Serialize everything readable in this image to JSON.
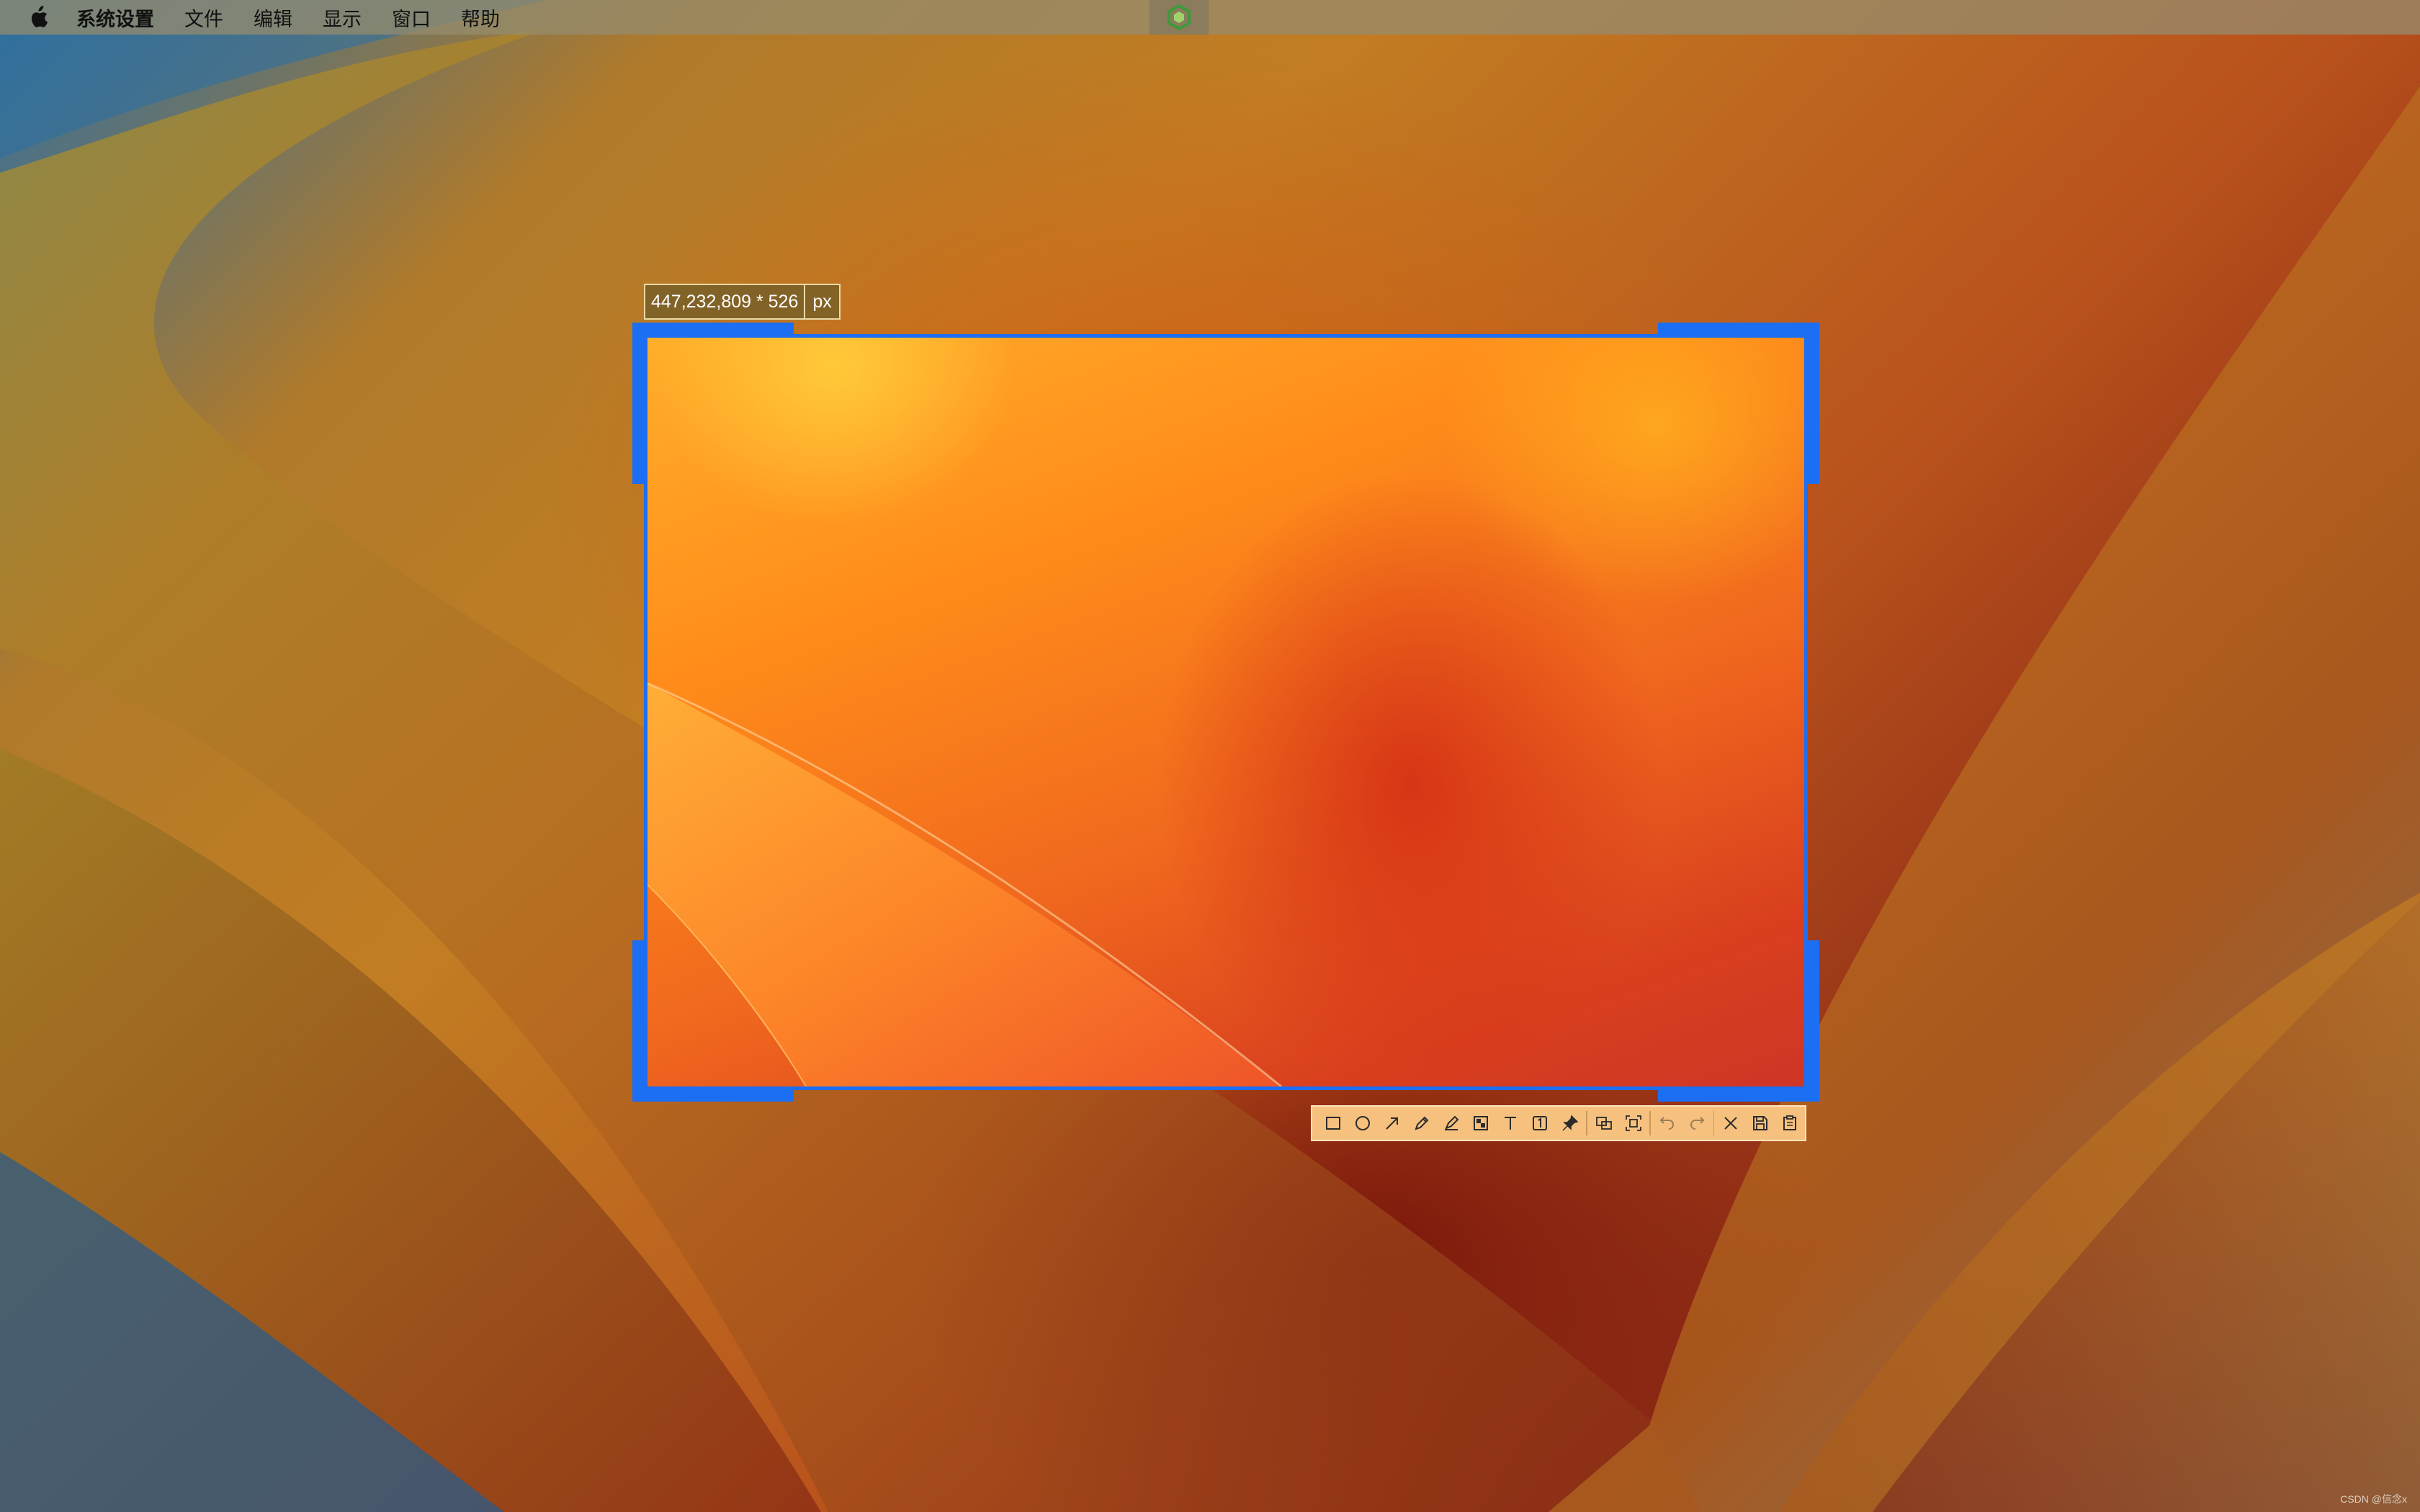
{
  "menubar": {
    "app_name": "系统设置",
    "items": [
      "文件",
      "编辑",
      "显示",
      "窗口",
      "帮助"
    ]
  },
  "screenshot": {
    "dimensions": "447,232,809 * 526",
    "unit": "px"
  },
  "toolbar": {
    "tools": [
      "rectangle-icon",
      "ellipse-icon",
      "arrow-icon",
      "pen-icon",
      "marker-icon",
      "mosaic-icon",
      "text-icon",
      "number-icon",
      "pin-icon",
      "ocr-icon",
      "scroll-capture-icon",
      "undo-icon",
      "redo-icon",
      "close-icon",
      "save-icon",
      "copy-icon"
    ]
  },
  "colors": {
    "selection_border": "#1c6ef2",
    "toolbar_bg": "#f6c17e"
  },
  "watermark": "CSDN @信念x"
}
